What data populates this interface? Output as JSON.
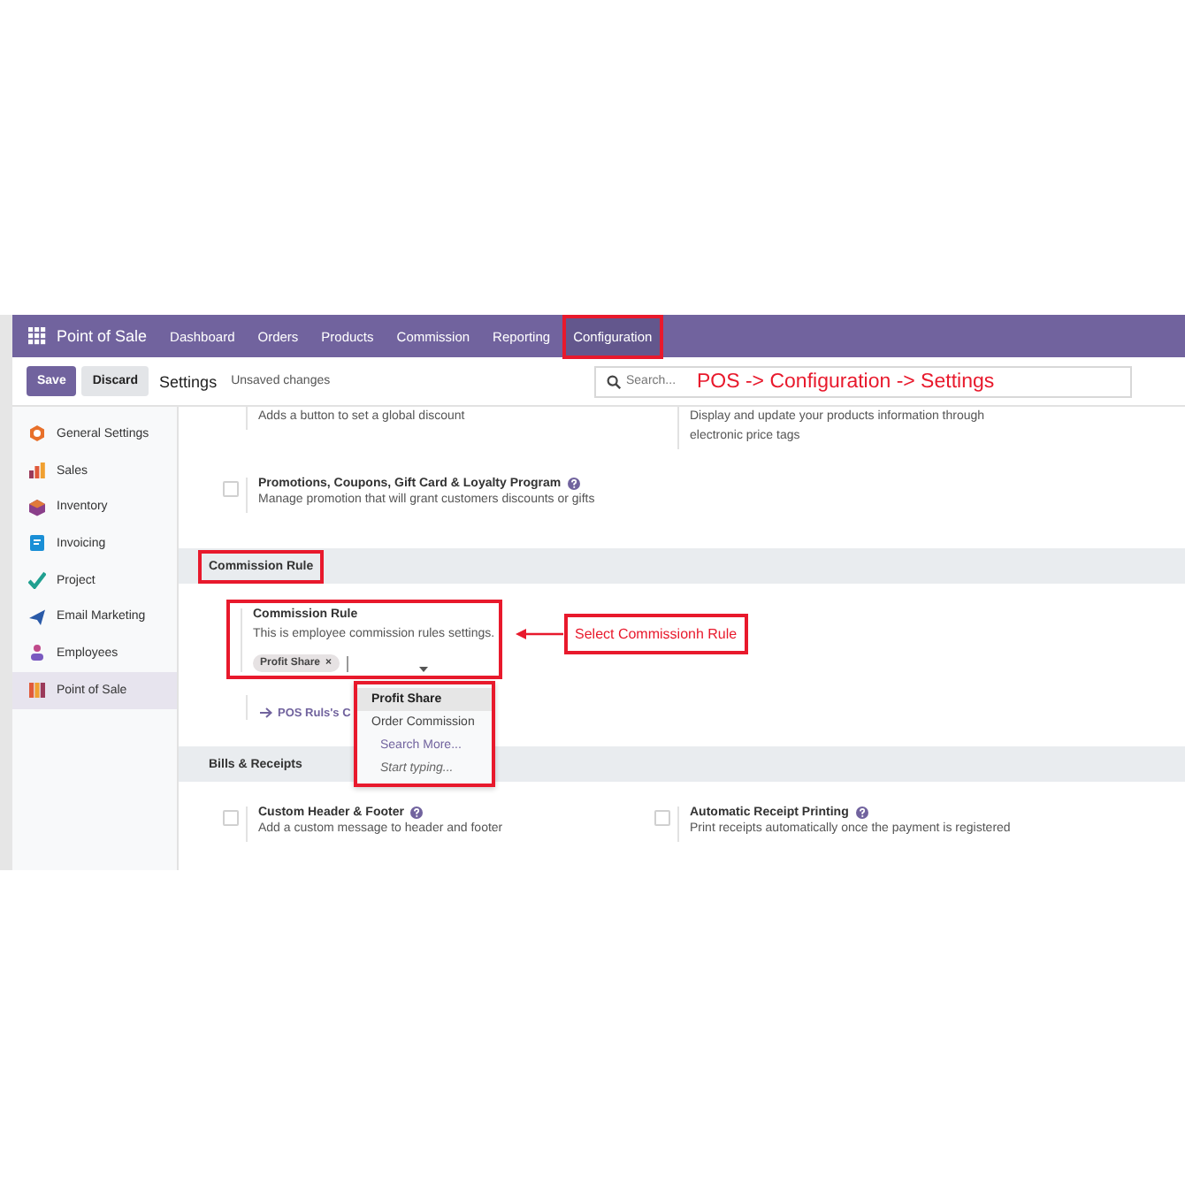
{
  "navbar": {
    "app_name": "Point of Sale",
    "menu": [
      {
        "label": "Dashboard",
        "selected": false,
        "annotated": false
      },
      {
        "label": "Orders",
        "selected": false,
        "annotated": false
      },
      {
        "label": "Products",
        "selected": false,
        "annotated": false
      },
      {
        "label": "Commission",
        "selected": false,
        "annotated": false
      },
      {
        "label": "Reporting",
        "selected": false,
        "annotated": false
      },
      {
        "label": "Configuration",
        "selected": true,
        "annotated": true
      }
    ]
  },
  "control_panel": {
    "buttons": [
      {
        "label": "Save",
        "kind": "primary"
      },
      {
        "label": "Discard",
        "kind": "secondary"
      }
    ],
    "breadcrumb": "Settings",
    "status": "Unsaved changes",
    "search": {
      "placeholder": "Search..."
    },
    "annotation": "POS -> Configuration -> Settings"
  },
  "sidebar": {
    "items": [
      {
        "label": "General Settings",
        "selected": false
      },
      {
        "label": "Sales",
        "selected": false
      },
      {
        "label": "Inventory",
        "selected": false
      },
      {
        "label": "Invoicing",
        "selected": false
      },
      {
        "label": "Project",
        "selected": false
      },
      {
        "label": "Email Marketing",
        "selected": false
      },
      {
        "label": "Employees",
        "selected": false
      },
      {
        "label": "Point of Sale",
        "selected": true
      }
    ]
  },
  "content": [
    {
      "kind": "partial",
      "settings": [
        {
          "description": "Adds a button to set a global discount"
        },
        {
          "description": "Display and update your products information through electronic price tags"
        }
      ]
    },
    {
      "kind": "setting_row",
      "settings": [
        {
          "title": "Promotions, Coupons, Gift Card & Loyalty Program",
          "help": true,
          "checked": false,
          "description": "Manage promotion that will grant customers discounts or gifts"
        }
      ]
    },
    {
      "kind": "section",
      "title": "Commission Rule",
      "annotated": true
    },
    {
      "kind": "tags_setting",
      "title": "Commission Rule",
      "description": "This is employee commission rules settings.",
      "annotated": true,
      "tags": [
        {
          "label": "Profit Share",
          "remove": "×"
        }
      ],
      "link": "POS Ruls's C",
      "callout": "Select Commissionh Rule",
      "dropdown": {
        "annotated": true,
        "options": [
          {
            "label": "Profit Share",
            "selected": true
          },
          {
            "label": "Order Commission",
            "selected": false
          }
        ],
        "search_more": "Search More...",
        "hint": "Start typing..."
      }
    },
    {
      "kind": "section",
      "title": "Bills & Receipts",
      "annotated": false
    },
    {
      "kind": "setting_row",
      "settings": [
        {
          "title": "Custom Header & Footer",
          "help": true,
          "checked": false,
          "description": "Add a custom message to header and footer"
        },
        {
          "title": "Automatic Receipt Printing",
          "help": true,
          "checked": false,
          "description": "Print receipts automatically once the payment is registered"
        }
      ]
    }
  ]
}
